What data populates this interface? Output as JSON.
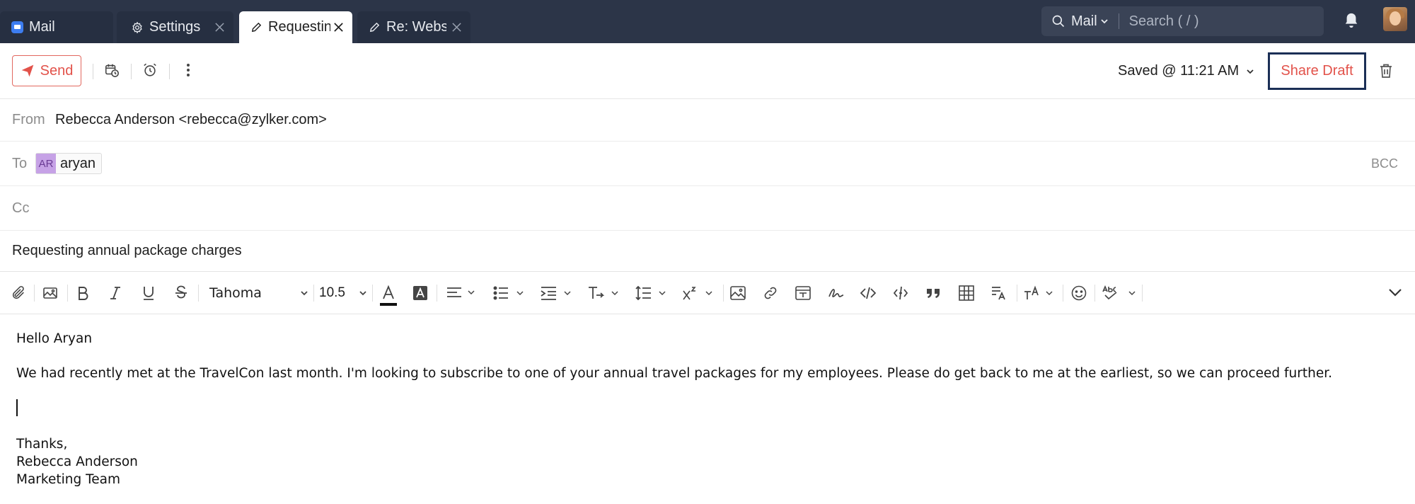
{
  "tabs": [
    {
      "label": "Mail",
      "icon": "mail-app-icon"
    },
    {
      "label": "Settings",
      "icon": "gear-icon"
    },
    {
      "label": "Requesting annual package charges",
      "icon": "pencil-icon",
      "active": true
    },
    {
      "label": "Re: Website",
      "icon": "pencil-icon"
    }
  ],
  "search": {
    "scope": "Mail",
    "placeholder": "Search ( / )"
  },
  "toolbar": {
    "send_label": "Send",
    "saved_status": "Saved @ 11:21 AM",
    "share_label": "Share Draft"
  },
  "compose": {
    "from_label": "From",
    "from_value": "Rebecca Anderson <rebecca@zylker.com>",
    "to_label": "To",
    "to_chip": {
      "initials": "AR",
      "name": "aryan"
    },
    "bcc_label": "BCC",
    "cc_label": "Cc",
    "subject": "Requesting annual package charges"
  },
  "format": {
    "font": "Tahoma",
    "size": "10.5"
  },
  "body": {
    "greeting": "Hello Aryan",
    "paragraph": "We had recently met at the TravelCon last month. I'm looking to subscribe to one of your annual travel packages for my employees. Please do get back to me at the earliest, so we can proceed further.",
    "sign_off": "Thanks,",
    "sign_name": "Rebecca Anderson",
    "sign_team": "Marketing Team"
  },
  "colors": {
    "accent": "#e2524a",
    "topbar": "#2c3548",
    "focus_border": "#1b2f56",
    "chip_avatar": "#c6a2e6"
  }
}
